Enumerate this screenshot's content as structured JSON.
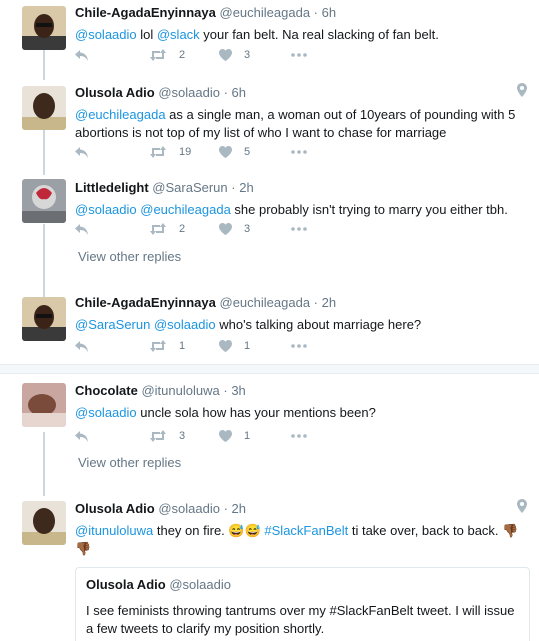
{
  "tweets": [
    {
      "name": "Chile-AgadaEnyinnaya",
      "handle": "@euchileagada",
      "time": "6h",
      "text": [
        {
          "t": "@solaadio",
          "k": "mention"
        },
        {
          "t": " lol ",
          "k": "plain"
        },
        {
          "t": "@slack",
          "k": "mention"
        },
        {
          "t": " your fan belt. Na real slacking of fan belt.",
          "k": "plain"
        }
      ],
      "retweets": "2",
      "likes": "3"
    },
    {
      "name": "Olusola Adio",
      "handle": "@solaadio",
      "time": "6h",
      "text": [
        {
          "t": "@euchileagada",
          "k": "mention"
        },
        {
          "t": " as a single man, a woman out of 10years of pounding with 5 abortions is not top of my list of who I want to chase for marriage",
          "k": "plain"
        }
      ],
      "retweets": "19",
      "likes": "5"
    },
    {
      "name": "Littledelight",
      "handle": "@SaraSerun",
      "time": "2h",
      "text": [
        {
          "t": "@solaadio",
          "k": "mention"
        },
        {
          "t": " ",
          "k": "plain"
        },
        {
          "t": "@euchileagada",
          "k": "mention"
        },
        {
          "t": " she probably isn't trying to marry you either tbh.",
          "k": "plain"
        }
      ],
      "retweets": "2",
      "likes": "3"
    },
    {
      "name": "Chile-AgadaEnyinnaya",
      "handle": "@euchileagada",
      "time": "2h",
      "text": [
        {
          "t": "@SaraSerun",
          "k": "mention"
        },
        {
          "t": " ",
          "k": "plain"
        },
        {
          "t": "@solaadio",
          "k": "mention"
        },
        {
          "t": " who's talking about marriage here?",
          "k": "plain"
        }
      ],
      "retweets": "1",
      "likes": "1"
    },
    {
      "name": "Chocolate",
      "handle": "@itunuloluwa",
      "time": "3h",
      "text": [
        {
          "t": "@solaadio",
          "k": "mention"
        },
        {
          "t": " uncle sola how has your mentions been?",
          "k": "plain"
        }
      ],
      "retweets": "3",
      "likes": "1"
    },
    {
      "name": "Olusola Adio",
      "handle": "@solaadio",
      "time": "2h",
      "text": [
        {
          "t": "@itunuloluwa",
          "k": "mention"
        },
        {
          "t": " they on fire. ",
          "k": "plain"
        },
        {
          "t": "😅😅",
          "k": "emoji"
        },
        {
          "t": " ",
          "k": "plain"
        },
        {
          "t": "#SlackFanBelt",
          "k": "hashtag"
        },
        {
          "t": " ti take over, back to back. ",
          "k": "plain"
        },
        {
          "t": "👎🏾👎🏾",
          "k": "emoji"
        }
      ]
    }
  ],
  "view_other_replies": "View other replies",
  "quote": {
    "name": "Olusola Adio",
    "handle": "@solaadio",
    "text": "I see feminists throwing tantrums over my #SlackFanBelt tweet. I will issue a few tweets to clarify my position shortly."
  },
  "separator_dot": "·",
  "icons": {
    "reply": "reply-icon",
    "retweet": "retweet-icon",
    "like": "heart-icon",
    "more": "more-dots-icon",
    "location": "location-pin-icon"
  },
  "colors": {
    "link": "#1b95e0",
    "icon": "#aab8c2",
    "muted": "#657786"
  }
}
